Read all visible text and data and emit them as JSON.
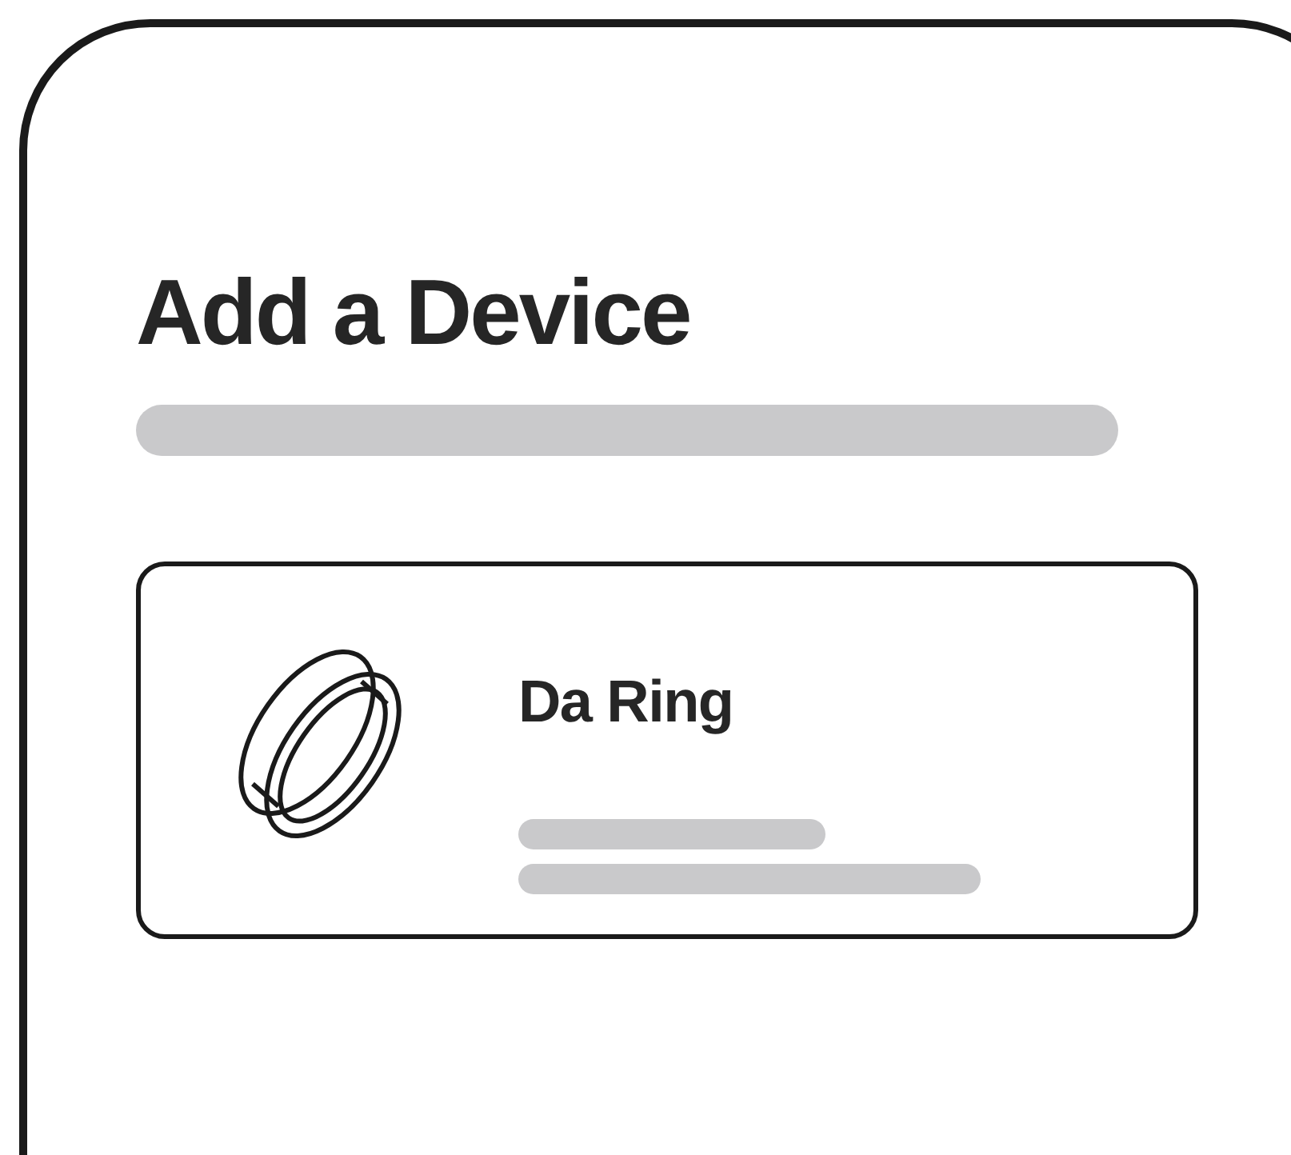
{
  "screen": {
    "title": "Add a Device",
    "devices": [
      {
        "name": "Da Ring"
      }
    ]
  }
}
